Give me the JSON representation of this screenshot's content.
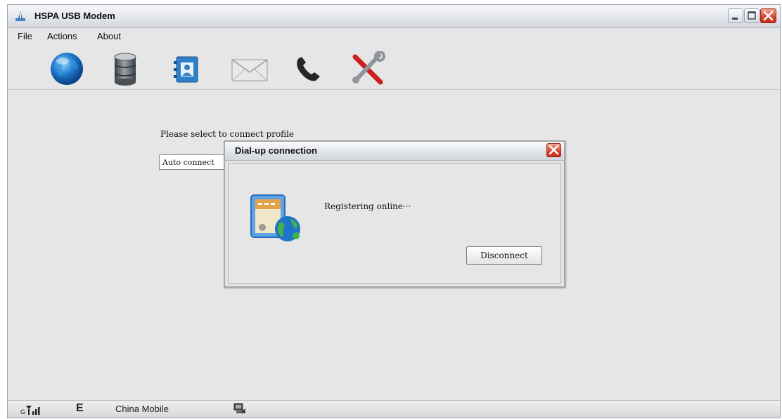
{
  "window": {
    "title": "HSPA USB Modem",
    "icons": [
      "app-icon",
      "minimize-icon",
      "maximize-icon",
      "close-icon"
    ]
  },
  "menu": {
    "items": [
      "File",
      "Actions",
      "About"
    ]
  },
  "toolbar": {
    "icons": [
      "globe-icon",
      "database-icon",
      "contacts-icon",
      "envelope-icon",
      "phone-icon",
      "tools-icon"
    ]
  },
  "main": {
    "prompt": "Please select to connect profile",
    "profile_value": "Auto connect"
  },
  "dialog": {
    "title": "Dial-up connection",
    "message": "Registering online···",
    "disconnect_label": "Disconnect",
    "icon": "dialup-connection-icon"
  },
  "status": {
    "network_type": "E",
    "carrier": "China Mobile",
    "icons": [
      "signal-strength-icon",
      "network-link-icon"
    ]
  },
  "colors": {
    "close_button": "#d8432a",
    "window_bg": "#e6e6e6",
    "globe": "#1e74c8"
  }
}
